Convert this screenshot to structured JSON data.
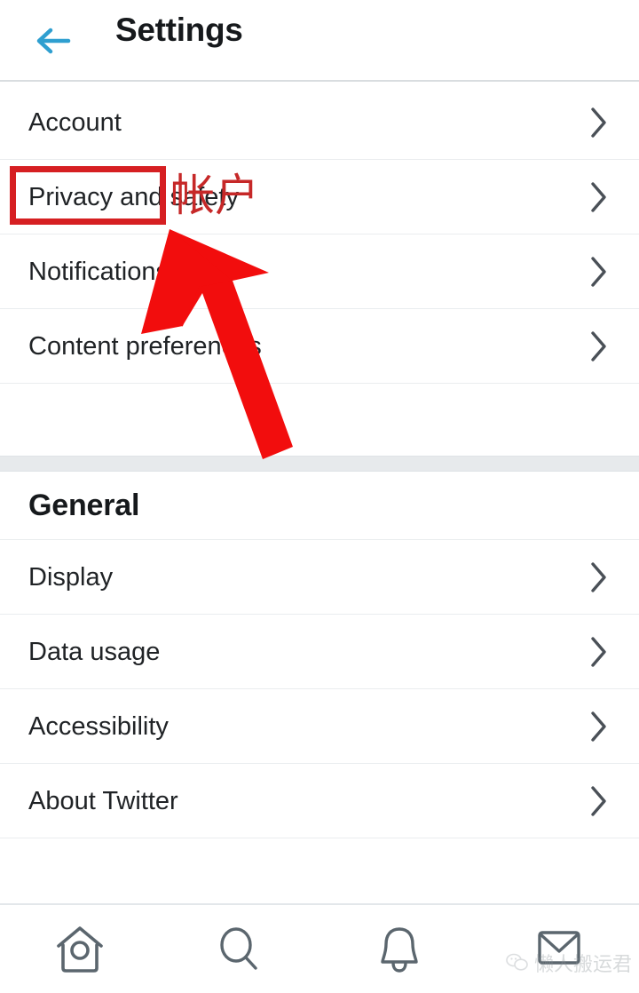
{
  "header": {
    "title": "Settings",
    "back_icon": "arrow-left-icon",
    "back_color": "#2f9fd0"
  },
  "sections": [
    {
      "id": "account-section",
      "title": "",
      "rows": [
        {
          "label": "Account",
          "chevron": "chevron-right-icon"
        },
        {
          "label": "Privacy and safety",
          "chevron": "chevron-right-icon"
        },
        {
          "label": "Notifications",
          "chevron": "chevron-right-icon"
        },
        {
          "label": "Content preferences",
          "chevron": "chevron-right-icon"
        }
      ]
    },
    {
      "id": "general-section",
      "title": "General",
      "rows": [
        {
          "label": "Display",
          "chevron": "chevron-right-icon"
        },
        {
          "label": "Data usage",
          "chevron": "chevron-right-icon"
        },
        {
          "label": "Accessibility",
          "chevron": "chevron-right-icon"
        },
        {
          "label": "About Twitter",
          "chevron": "chevron-right-icon"
        }
      ]
    }
  ],
  "annotation": {
    "highlight_target": "Account",
    "translation_text": "帐户",
    "box_color": "#d61f22",
    "text_color": "#c62828",
    "arrow_color": "#f20d0d",
    "arrow_points_to": "Account"
  },
  "bottom_nav": {
    "items": [
      {
        "icon": "home-icon",
        "label": "Home"
      },
      {
        "icon": "search-icon",
        "label": "Search"
      },
      {
        "icon": "bell-icon",
        "label": "Notifications"
      },
      {
        "icon": "envelope-icon",
        "label": "Messages"
      }
    ],
    "icon_color": "#5b666e"
  },
  "watermark": {
    "text": "懒人搬运君",
    "icon": "wechat-icon"
  }
}
